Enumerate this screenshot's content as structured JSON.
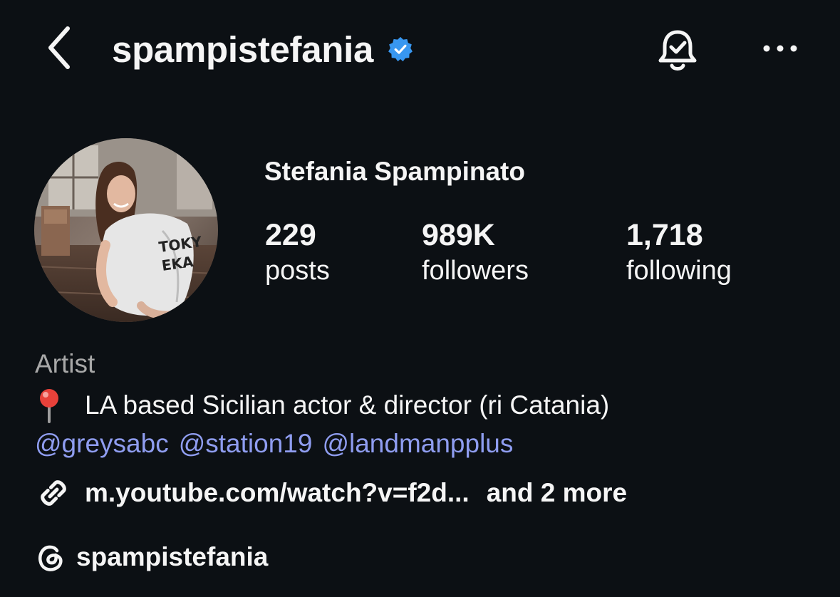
{
  "header": {
    "username": "spampistefania",
    "back_icon": "chevron-left-icon",
    "verified_icon": "verified-badge-icon",
    "notification_icon": "bell-check-icon",
    "more_icon": "more-horizontal-icon"
  },
  "profile": {
    "full_name": "Stefania Spampinato",
    "avatar_icon": "profile-photo",
    "stats": {
      "posts": {
        "value": "229",
        "label": "posts"
      },
      "followers": {
        "value": "989K",
        "label": "followers"
      },
      "following": {
        "value": "1,718",
        "label": "following"
      }
    }
  },
  "bio": {
    "category": "Artist",
    "pin_icon": "round-pushpin-icon",
    "text": "LA based Sicilian actor & director (ri Catania)",
    "mentions": [
      "@greysabc",
      "@station19",
      "@landmanpplus"
    ],
    "link_icon": "link-icon",
    "link_url": "m.youtube.com/watch?v=f2d...",
    "link_more": "and 2 more",
    "threads_icon": "threads-icon",
    "threads_handle": "spampistefania"
  },
  "colors": {
    "background": "#0c1014",
    "text": "#f5f5f5",
    "secondary_text": "#a8a8a8",
    "mention": "#8f9df0",
    "verified": "#3897f0"
  }
}
